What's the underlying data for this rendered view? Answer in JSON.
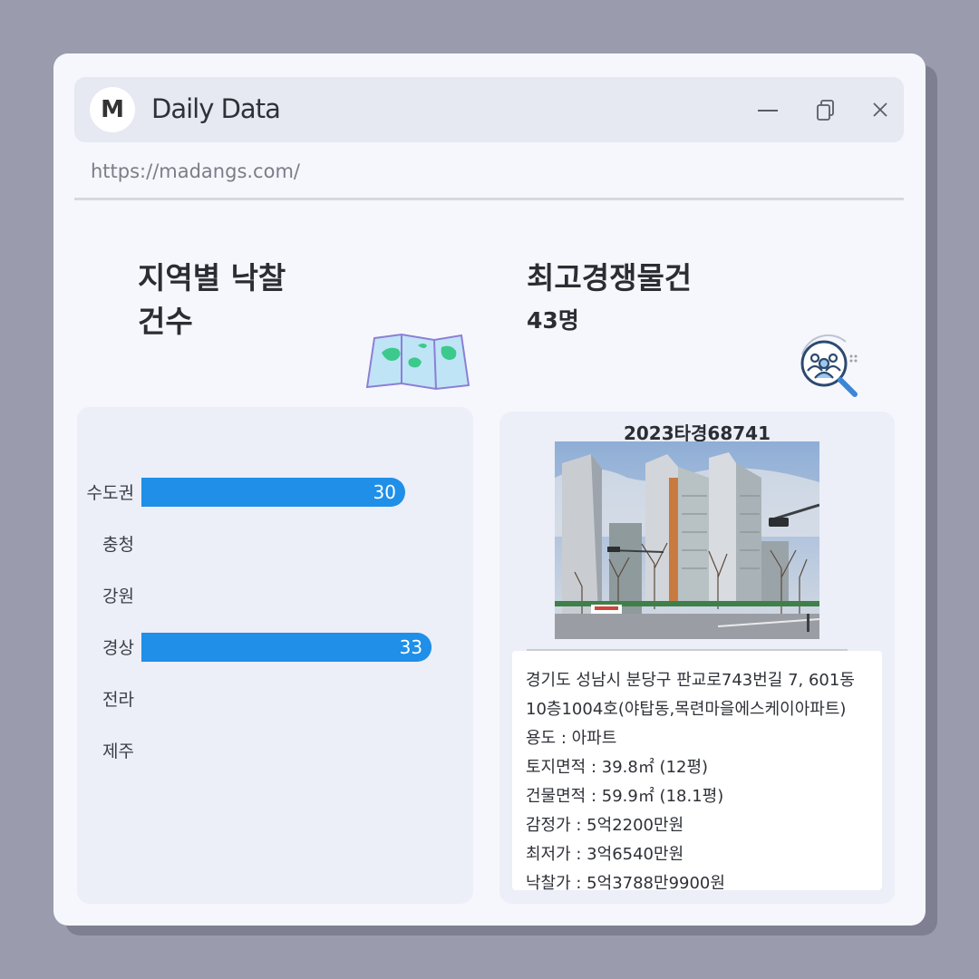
{
  "app": {
    "logo_letter": "M",
    "title": "Daily Data",
    "url": "https://madangs.com/"
  },
  "window_controls": [
    "minimize-icon",
    "restore-icon",
    "close-icon"
  ],
  "left_section": {
    "title_line1": "지역별 낙찰",
    "title_line2": "건수",
    "icon": "map-icon"
  },
  "right_section": {
    "title": "최고경쟁물건",
    "subtitle": "43명",
    "icon": "people-search-icon"
  },
  "chart_data": {
    "type": "bar",
    "orientation": "horizontal",
    "categories": [
      "수도권",
      "충청",
      "강원",
      "경상",
      "전라",
      "제주"
    ],
    "values": [
      30,
      null,
      null,
      33,
      null,
      null
    ],
    "color": "#1f8fe8"
  },
  "property": {
    "case_number": "2023타경68741",
    "address_line1": "경기도 성남시 분당구 판교로743번길 7, 601동",
    "address_line2": "10층1004호(야탑동,목련마을에스케이아파트)",
    "usage": "용도 : 아파트",
    "land_area": "토지면적 : 39.8㎡ (12평)",
    "building_area": "건물면적 : 59.9㎡ (18.1평)",
    "appraisal": "감정가 : 5억2200만원",
    "minimum": "최저가 : 3억6540만원",
    "winning_bid": "낙찰가 : 5억3788만9900원"
  },
  "colors": {
    "background": "#9a9cad",
    "window": "#f6f7fd",
    "titlebar": "#e6e8f2",
    "panel": "#eceef8",
    "bar": "#1f8fe8"
  }
}
